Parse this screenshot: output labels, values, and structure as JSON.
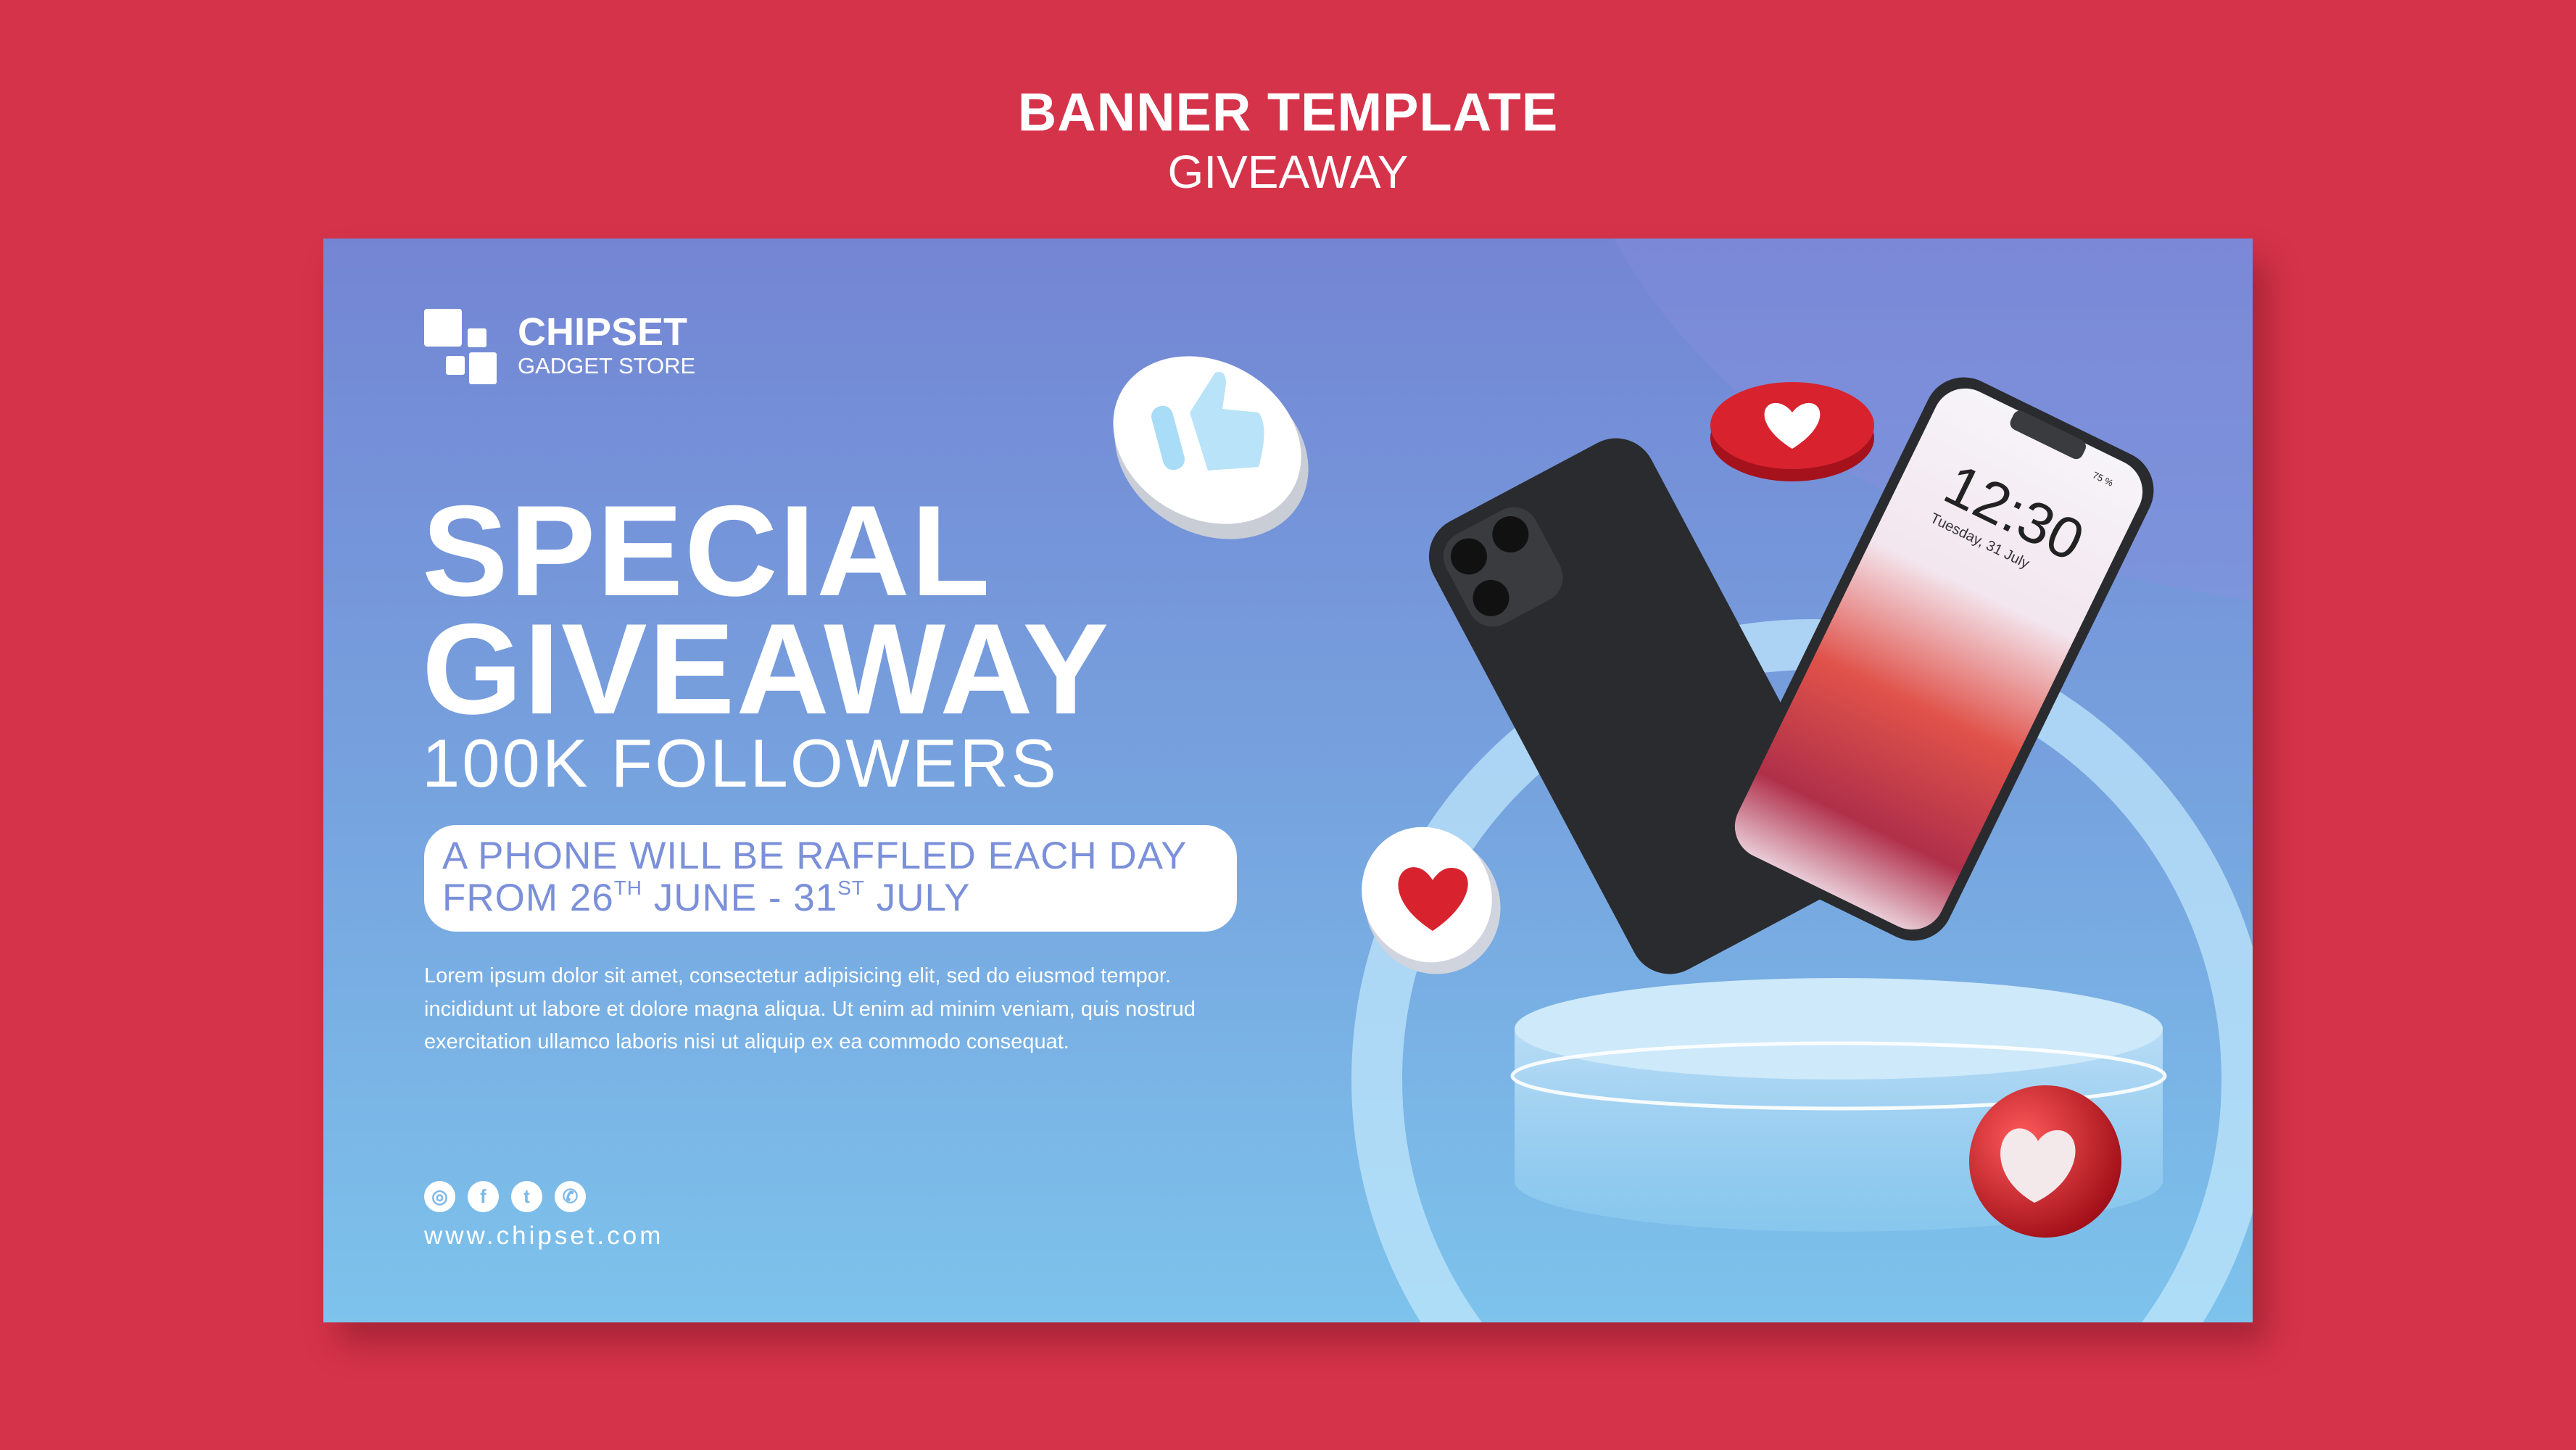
{
  "header": {
    "title": "BANNER TEMPLATE",
    "subtitle": "GIVEAWAY"
  },
  "colors": {
    "background": "#d5334a",
    "banner_top": "#7485d4",
    "banner_bottom": "#7dc3ec",
    "pill_text": "#7b90d9",
    "heart_red": "#d8232f"
  },
  "brand": {
    "name": "CHIPSET",
    "tagline": "GADGET STORE",
    "logo_icon": "stacked-squares-icon"
  },
  "headline": {
    "line1": "SPECIAL",
    "line2": "GIVEAWAY",
    "line3": "100K FOLLOWERS"
  },
  "pill": {
    "line1": "A PHONE WILL BE RAFFLED EACH DAY",
    "from": "FROM 26",
    "th": "TH",
    "mid": " JUNE - 31",
    "st": "ST",
    "end": " JULY"
  },
  "body_text": [
    "Lorem ipsum dolor sit amet, consectetur adipisicing elit, sed do eiusmod tempor.",
    "incididunt ut labore et dolore magna aliqua. Ut enim ad minim veniam, quis nostrud",
    "exercitation ullamco laboris nisi ut aliquip ex ea commodo consequat."
  ],
  "social": [
    {
      "icon": "instagram-icon",
      "glyph": "◎"
    },
    {
      "icon": "facebook-icon",
      "glyph": "f"
    },
    {
      "icon": "twitter-icon",
      "glyph": "t"
    },
    {
      "icon": "whatsapp-icon",
      "glyph": "✆"
    }
  ],
  "website": "www.chipset.com",
  "phone_screen": {
    "time": "12:30",
    "date": "Tuesday, 31 July",
    "battery": "75 %"
  },
  "decor_icons": [
    "thumbs-up-icon",
    "heart-icon",
    "heart-icon",
    "heart-icon"
  ]
}
